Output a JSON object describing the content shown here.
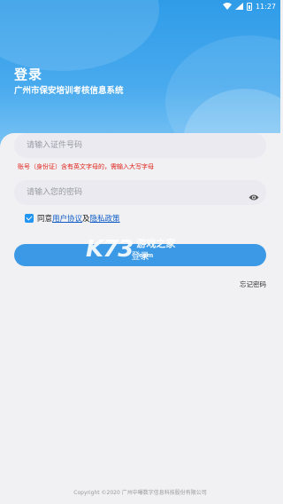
{
  "status_bar": {
    "time": "11:27"
  },
  "header": {
    "title": "登录",
    "subtitle": "广州市保安培训考核信息系统"
  },
  "form": {
    "id_placeholder": "请输入证件号码",
    "id_hint": "账号（身份证）含有英文字母的，需输入大写字母",
    "password_placeholder": "请输入您的密码",
    "agreement_prefix": "同意",
    "user_agreement": "用户协议",
    "agreement_and": "及",
    "privacy_policy": "隐私政策",
    "agree_checked": true,
    "login_label": "登录",
    "forgot_password": "忘记密码"
  },
  "watermark": {
    "logo": "K73",
    "text": "游戏之家",
    "subtext": ".com"
  },
  "footer": {
    "copyright": "Copyright ©2020 广州中曝数字信息科技股份有限公司"
  },
  "colors": {
    "primary": "#3c99e6",
    "hint": "#e0221a",
    "link": "#0f5cc8"
  }
}
